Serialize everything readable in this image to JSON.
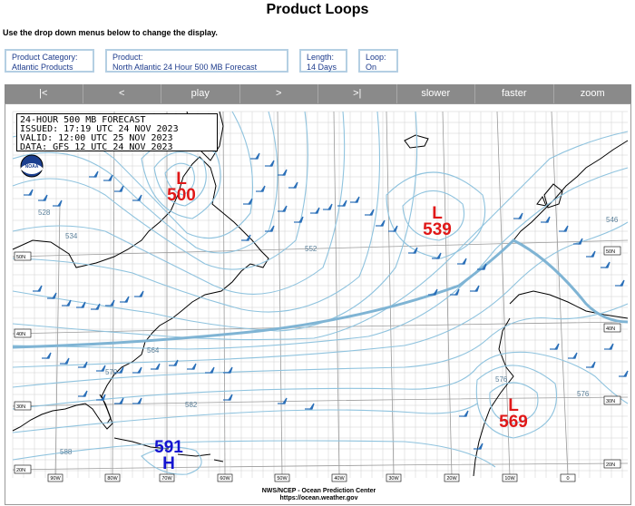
{
  "page": {
    "title": "Product Loops",
    "instructions": "Use the drop down menus below to change the display."
  },
  "selectors": [
    {
      "label": "Product Category:",
      "value": "Atlantic Products"
    },
    {
      "label": "Product:",
      "value": "North Atlantic 24 Hour 500 MB Forecast"
    },
    {
      "label": "Length:",
      "value": "14 Days"
    },
    {
      "label": "Loop:",
      "value": "On"
    }
  ],
  "controls": [
    "|<",
    "<",
    "play",
    ">",
    ">|",
    "slower",
    "faster",
    "zoom"
  ],
  "map": {
    "info": {
      "line1": "24-HOUR 500 MB FORECAST",
      "line2": "ISSUED: 17:19 UTC 24 NOV 2023",
      "line3": "VALID:  12:00 UTC 25 NOV 2023",
      "line4": "DATA:   GFS 12 UTC 24 NOV 2023"
    },
    "logo": "noaa-logo",
    "systems": [
      {
        "type": "L",
        "value": "500",
        "color": "#e01818"
      },
      {
        "type": "L",
        "value": "539",
        "color": "#e01818"
      },
      {
        "type": "L",
        "value": "569",
        "color": "#e01818"
      },
      {
        "type": "H",
        "value": "591",
        "color": "#1414d0"
      }
    ],
    "contour_labels": [
      "528",
      "534",
      "552",
      "564",
      "570",
      "576",
      "582",
      "588",
      "576",
      "546"
    ],
    "lat_labels_left": [
      "50N",
      "40N",
      "30N",
      "20N"
    ],
    "lat_labels_right": [
      "50N",
      "40N",
      "30N",
      "20N"
    ],
    "lon_labels": [
      "90W",
      "80W",
      "70W",
      "60W",
      "50W",
      "40W",
      "30W",
      "20W",
      "10W",
      "0"
    ],
    "credit_line1": "NWS/NCEP - Ocean Prediction Center",
    "credit_line2": "https://ocean.weather.gov",
    "contour_color": "#8fc3de",
    "wind_color": "#2a6fb8"
  }
}
